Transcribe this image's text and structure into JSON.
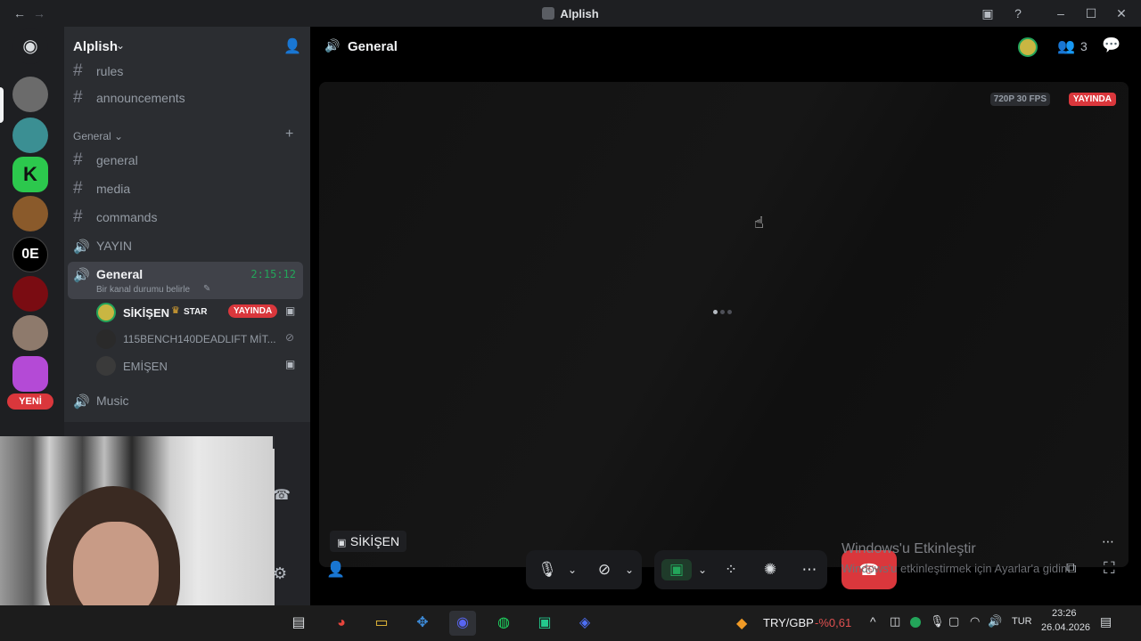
{
  "window": {
    "title": "Alplish"
  },
  "server": {
    "name": "Alplish",
    "new_badge": "YENİ"
  },
  "channels": {
    "top": [
      {
        "icon": "hash-icon",
        "label": "rules"
      },
      {
        "icon": "hash-icon",
        "label": "announcements"
      }
    ],
    "category": "General",
    "list": [
      {
        "icon": "hash-icon",
        "label": "general"
      },
      {
        "icon": "hash-icon",
        "label": "media"
      },
      {
        "icon": "hash-icon",
        "label": "commands"
      },
      {
        "icon": "speaker-icon",
        "label": "YAYIN"
      }
    ],
    "active_voice": {
      "label": "General",
      "timer": "2:15:12",
      "status": "Bir kanal durumu belirle"
    },
    "voice_users": [
      {
        "name": "SİKİŞEN",
        "tag": "STAR",
        "badge": "YAYINDA"
      },
      {
        "name": "115BENCH140DEADLIFT MİT..."
      },
      {
        "name": "EMİŞEN"
      }
    ],
    "after": [
      {
        "icon": "speaker-icon",
        "label": "Music"
      }
    ]
  },
  "main": {
    "title": "General",
    "member_count": "3",
    "quality": "720P 30 FPS",
    "live_badge": "YAYINDA",
    "streamer": "SİKİŞEN"
  },
  "watermark": {
    "line1": "Windows'u Etkinleştir",
    "line2": "Windows'u etkinleştirmek için Ayarlar'a gidin."
  },
  "taskbar": {
    "currency": "TRY/GBP",
    "change": "-%0,61",
    "lang": "TUR",
    "time": "23:26",
    "date": "26.04.2026"
  },
  "colors": {
    "live": "#da373c",
    "accent": "#5865f2",
    "online": "#23a55a",
    "hangup": "#da373c"
  }
}
